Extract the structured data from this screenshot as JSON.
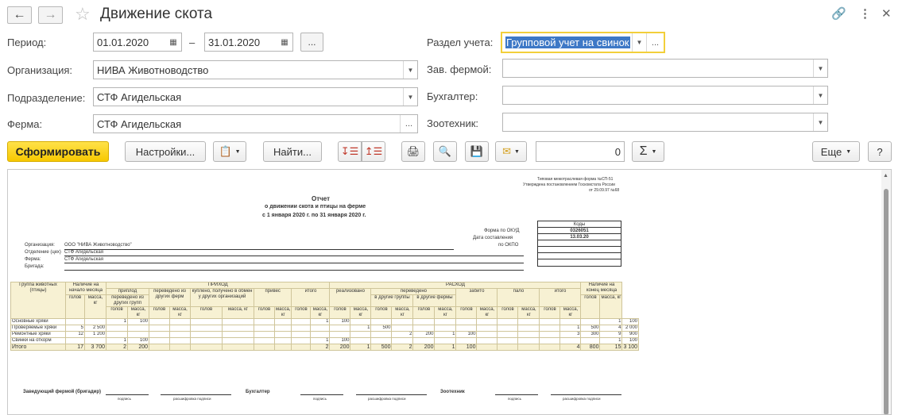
{
  "header": {
    "back_icon": "arrow-left-icon",
    "forward_icon": "arrow-right-icon",
    "title": "Движение скота",
    "favorite_icon": "star-icon"
  },
  "form": {
    "period_label": "Период:",
    "date_from": "01.01.2020",
    "date_dash": "–",
    "date_to": "31.01.2020",
    "dots": "...",
    "organization_label": "Организация:",
    "organization_value": "НИВА Животноводство",
    "subdivision_label": "Подразделение:",
    "subdivision_value": "СТФ Агидельская",
    "farm_label": "Ферма:",
    "farm_value": "СТФ Агидельская",
    "section_label": "Раздел учета:",
    "section_value": "Групповой учет на свинок",
    "manager_label": "Зав. фермой:",
    "accountant_label": "Бухгалтер:",
    "zootechnician_label": "Зоотехник:"
  },
  "toolbar": {
    "generate": "Сформировать",
    "settings": "Настройки...",
    "find": "Найти...",
    "number_value": "0",
    "sum_symbol": "Σ",
    "more": "Еще",
    "help": "?"
  },
  "report": {
    "form_note_1": "Типовая межотраслевая форма №СП-51",
    "form_note_2": "Утверждена постановлением Госкомстата России",
    "form_note_3": "от 29.09.97 №68",
    "title": "Отчет",
    "subtitle": "о движении скота и птицы на ферме",
    "period": "с 1 января 2020 г. по 31 января 2020 г.",
    "codes_header": "Коды",
    "okud_label": "Форма по ОКУД",
    "okud_value": "0326051",
    "date_label": "Дата составления",
    "date_value": "13.03.20",
    "okpo_label": "по ОКПО",
    "org_label": "Организация:",
    "org_value": "ООО \"НИВА Животноводство\"",
    "dept_label": "Отделение (цех)",
    "dept_value": "СТФ Агидельская",
    "farm_label": "Ферма:",
    "farm_value": "СТФ Агидельская",
    "brigade_label": "Бригада:",
    "h_group": "Группа животных (птицы)",
    "h_start": "Наличие на начало месяца",
    "h_income": "ПРИХОД",
    "h_expense": "РАСХОД",
    "h_end": "Наличие на конец месяца",
    "h_heads": "голов",
    "h_mass": "масса, кг",
    "h_offspring": "приплод",
    "h_from_groups": "переведено из других групп",
    "h_from_farms": "переведено из других ферм",
    "h_bought": "куплено, получено в обмен у других организаций",
    "h_gain": "привес",
    "h_total": "итого",
    "h_sold": "реализовано",
    "h_transferred": "переведено",
    "h_to_groups": "в другие группы",
    "h_to_farms": "в другие фермы",
    "h_slaughtered": "забито",
    "h_died": "пало",
    "rows": [
      {
        "name": "Основные хряки",
        "cells": [
          "",
          "",
          "1",
          "100",
          "",
          "",
          "",
          "",
          "",
          "",
          "",
          "1",
          "100",
          "",
          "",
          "",
          "",
          "",
          "",
          "",
          "",
          "",
          "",
          "",
          "",
          "1",
          "100"
        ]
      },
      {
        "name": "Проверяемые хряки",
        "cells": [
          "5",
          "2 500",
          "",
          "",
          "",
          "",
          "",
          "",
          "",
          "",
          "",
          "",
          "",
          "1",
          "500",
          "",
          "",
          "",
          "",
          "",
          "",
          "",
          "",
          "1",
          "500",
          "4",
          "2 000"
        ]
      },
      {
        "name": "Ремонтные хряки",
        "cells": [
          "12",
          "1 200",
          "",
          "",
          "",
          "",
          "",
          "",
          "",
          "",
          "",
          "",
          "",
          "",
          "",
          "2",
          "200",
          "1",
          "100",
          "",
          "",
          "",
          "",
          "3",
          "300",
          "9",
          "900"
        ]
      },
      {
        "name": "Свинки на откорм",
        "cells": [
          "",
          "",
          "1",
          "100",
          "",
          "",
          "",
          "",
          "",
          "",
          "",
          "1",
          "100",
          "",
          "",
          "",
          "",
          "",
          "",
          "",
          "",
          "",
          "",
          "",
          "",
          "1",
          "100"
        ]
      }
    ],
    "total_row": {
      "name": "Итого",
      "cells": [
        "17",
        "3 700",
        "2",
        "200",
        "",
        "",
        "",
        "",
        "",
        "",
        "",
        "2",
        "200",
        "1",
        "500",
        "2",
        "200",
        "1",
        "100",
        "",
        "",
        "",
        "",
        "4",
        "800",
        "15",
        "3 100"
      ]
    },
    "sign_manager": "Заведующий фермой (бригадир)",
    "sign_accountant": "Бухгалтер",
    "sign_zoo": "Зоотехник",
    "sign_caption": "подпись",
    "sign_decode": "расшифровка подписи"
  }
}
